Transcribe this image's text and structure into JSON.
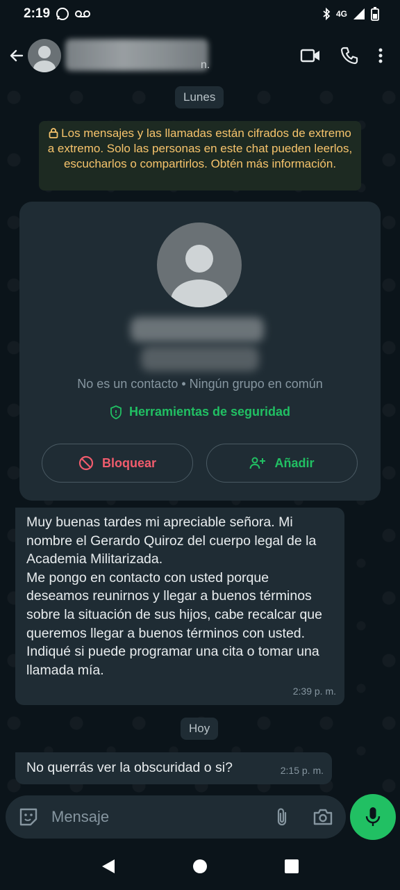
{
  "status_bar": {
    "time": "2:19",
    "network": "4G",
    "icons": [
      "whatsapp-icon",
      "voicemail-icon",
      "bluetooth-icon",
      "signal-icon",
      "battery-icon"
    ]
  },
  "header": {
    "contact_name_tail": "n.",
    "actions": [
      "video-call-icon",
      "voice-call-icon",
      "more-options-icon"
    ]
  },
  "chat": {
    "date_chip_1": "Lunes",
    "encryption_notice": "Los mensajes y las llamadas están cifrados de extremo a extremo. Solo las personas en este chat pueden leerlos, escucharlos o compartirlos. Obtén más información.",
    "contact_card": {
      "info": "No es un contacto • Ningún grupo en común",
      "security_tools": "Herramientas de seguridad",
      "block_label": "Bloquear",
      "add_label": "Añadir"
    },
    "messages": [
      {
        "text": "Muy buenas tardes mi apreciable señora. Mi nombre el Gerardo Quiroz del cuerpo legal de la Academia Militarizada.\nMe pongo en contacto con usted porque deseamos reunirnos y llegar a buenos términos sobre la situación de sus hijos, cabe recalcar que queremos llegar a buenos términos con usted.\nIndiqué si puede programar una cita o tomar una llamada mía.",
        "time": "2:39 p. m."
      },
      {
        "text": "No querrás ver la obscuridad o si?",
        "time": "2:15 p. m."
      }
    ],
    "date_chip_2": "Hoy"
  },
  "composer": {
    "placeholder": "Mensaje"
  },
  "colors": {
    "accent_green": "#21c063",
    "block_red": "#f15c6d",
    "encryption_yellow": "#f7c46c",
    "bubble": "#1f2c34",
    "background": "#0b141a"
  }
}
